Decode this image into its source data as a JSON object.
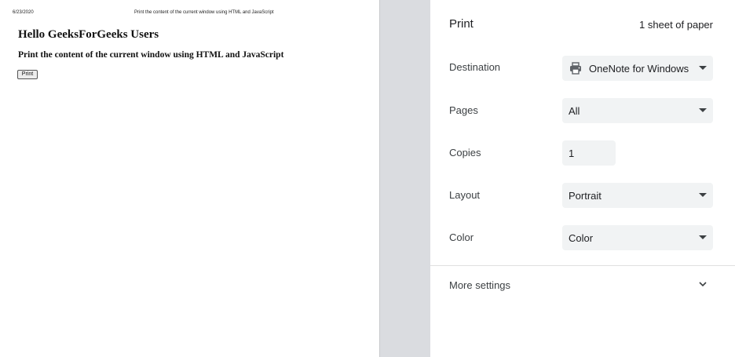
{
  "preview": {
    "date": "6/23/2020",
    "doc_title": "Print the content of the current window using HTML and JavaScript",
    "heading": "Hello GeeksForGeeks Users",
    "subheading": "Print the content of the current window using HTML and JavaScript",
    "button_label": "Print"
  },
  "panel": {
    "title": "Print",
    "sheet_count": "1 sheet of paper",
    "destination": {
      "label": "Destination",
      "value": "OneNote for Windows",
      "icon": "printer-icon"
    },
    "pages": {
      "label": "Pages",
      "value": "All"
    },
    "copies": {
      "label": "Copies",
      "value": "1"
    },
    "layout": {
      "label": "Layout",
      "value": "Portrait"
    },
    "color": {
      "label": "Color",
      "value": "Color"
    },
    "more_settings": {
      "label": "More settings",
      "icon": "chevron-down-icon"
    }
  },
  "colors": {
    "gutter": "#dadce0",
    "field_bg": "#f1f3f4",
    "text": "#202124"
  }
}
